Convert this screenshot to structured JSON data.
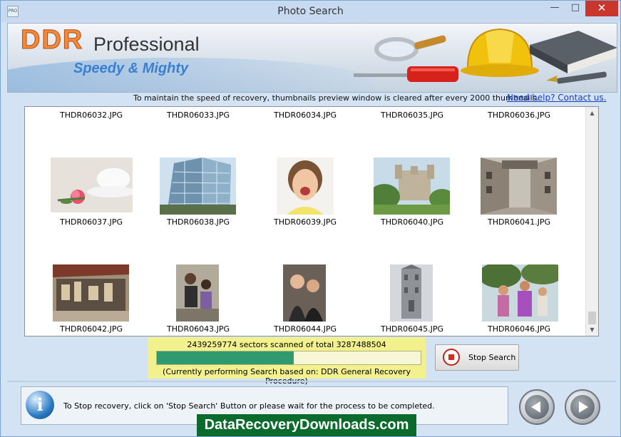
{
  "window": {
    "title": "Photo Search",
    "min": "—",
    "max": "□",
    "close": "✕"
  },
  "banner": {
    "brand": "DDR",
    "product": "Professional",
    "tagline": "Speedy & Mighty"
  },
  "notice": "To maintain the speed of recovery, thumbnails preview window is cleared after every 2000 thumbnails.",
  "help_link": "Need help? Contact us.",
  "gallery": {
    "items": [
      {
        "name": "THDR06032.JPG",
        "thumb": "none"
      },
      {
        "name": "THDR06033.JPG",
        "thumb": "none"
      },
      {
        "name": "THDR06034.JPG",
        "thumb": "none"
      },
      {
        "name": "THDR06035.JPG",
        "thumb": "none"
      },
      {
        "name": "THDR06036.JPG",
        "thumb": "none"
      },
      {
        "name": "THDR06037.JPG",
        "thumb": "teacup-rose"
      },
      {
        "name": "THDR06038.JPG",
        "thumb": "glass-building"
      },
      {
        "name": "THDR06039.JPG",
        "thumb": "crying-child"
      },
      {
        "name": "THDR06040.JPG",
        "thumb": "castle"
      },
      {
        "name": "THDR06041.JPG",
        "thumb": "street"
      },
      {
        "name": "THDR06042.JPG",
        "thumb": "market-stall"
      },
      {
        "name": "THDR06043.JPG",
        "thumb": "crowd"
      },
      {
        "name": "THDR06044.JPG",
        "thumb": "girls-talking"
      },
      {
        "name": "THDR06045.JPG",
        "thumb": "tower-bridge"
      },
      {
        "name": "THDR06046.JPG",
        "thumb": "parade"
      }
    ]
  },
  "progress": {
    "text": "2439259774 sectors scanned of total 3287488504",
    "scanned": 2439259774,
    "total": 3287488504,
    "fraction": 0.52,
    "procedure": "(Currently performing Search based on:  DDR General Recovery Procedure)"
  },
  "stop_button": "Stop Search",
  "status": "To Stop recovery, click on 'Stop Search' Button or please wait for the process to be completed.",
  "watermark": "DataRecoveryDownloads.com",
  "colors": {
    "accent": "#3a7fd1",
    "progress": "#2e9a6e",
    "close": "#c9362b",
    "highlight": "#f3f08e"
  }
}
